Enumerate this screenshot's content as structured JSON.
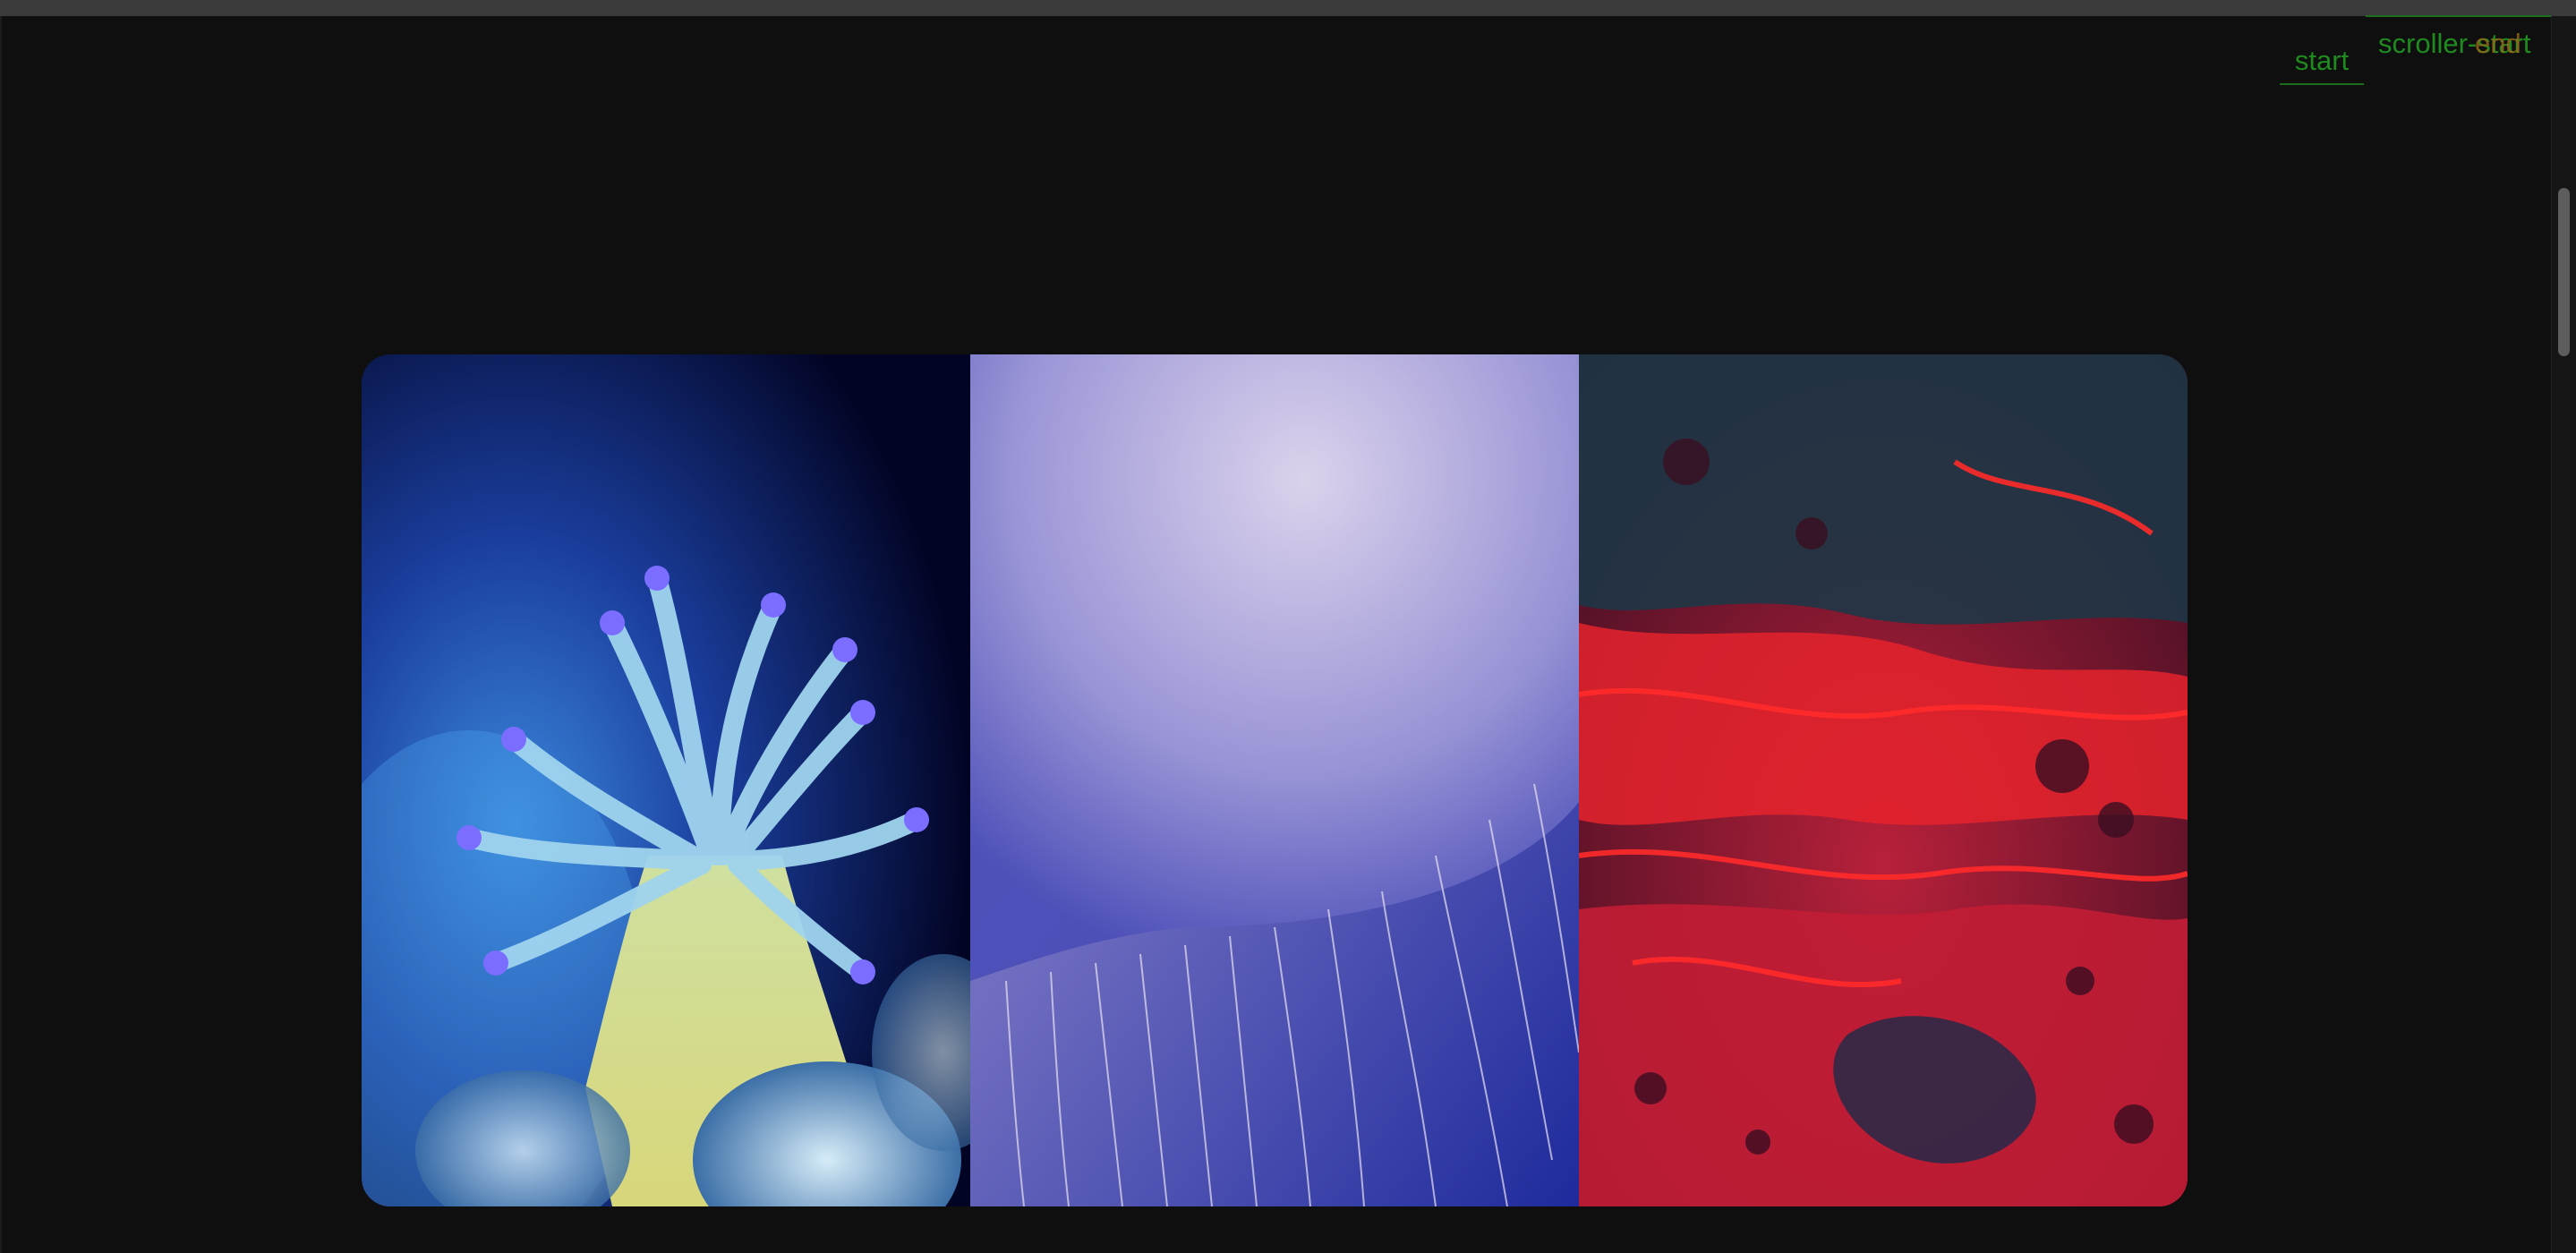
{
  "scroll_markers": {
    "start_label": "start",
    "scroller_label": "scroller-start",
    "overlap_label": "end"
  },
  "gallery": {
    "panels": [
      {
        "name": "anemone-image",
        "dominant_color": "#3f8fd8"
      },
      {
        "name": "jellyfish-image",
        "dominant_color": "#3b3fa8"
      },
      {
        "name": "red-fluid-image",
        "dominant_color": "#e0262e"
      }
    ]
  },
  "colors": {
    "background": "#0f0f0f",
    "marker": "#1f8a1f",
    "scrollbar_thumb": "#5d5d5d"
  }
}
